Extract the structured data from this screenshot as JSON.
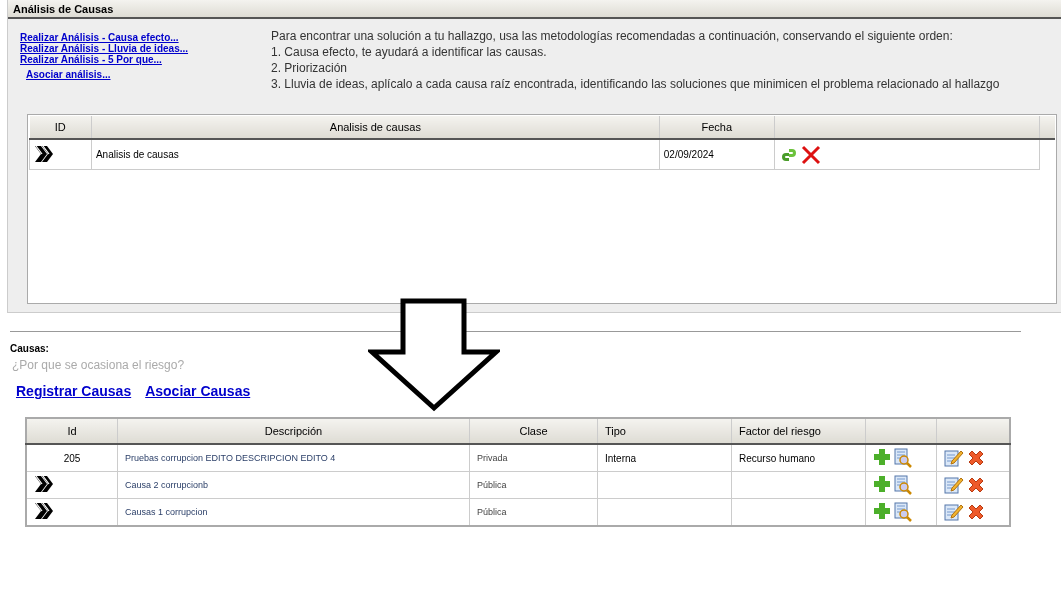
{
  "panel": {
    "title": "Análisis de Causas",
    "links": [
      "Realizar Análisis - Causa efecto...",
      "Realizar Análisis - Lluvia de ideas...",
      "Realizar Análisis - 5 Por que..."
    ],
    "associate_link": "Asociar análisis...",
    "instructions": [
      "Para encontrar una solución a tu hallazgo, usa las metodologías recomendadas a continuación, conservando el siguiente orden:",
      "1. Causa efecto, te ayudará a identificar las causas.",
      "2. Priorización",
      "3. Lluvia de ideas, aplícalo a cada causa raíz encontrada, identificando las soluciones que minimicen el problema relacionado al hallazgo"
    ],
    "table": {
      "columns": [
        "ID",
        "Analisis de causas",
        "Fecha"
      ],
      "rows": [
        {
          "kind": "pending",
          "name": "Analisis de causas",
          "date": "02/09/2024"
        }
      ]
    }
  },
  "causes": {
    "title": "Causas:",
    "question": "¿Por que se ocasiona el riesgo?",
    "links": [
      "Registrar Causas",
      "Asociar Causas"
    ],
    "table": {
      "columns": [
        "Id",
        "Descripción",
        "Clase",
        "Tipo",
        "Factor del riesgo"
      ],
      "rows": [
        {
          "kind": "numbered",
          "id": "205",
          "description": "Pruebas corrupcion EDITO DESCRIPCION EDITO 4",
          "class": "Privada",
          "type": "Interna",
          "factor": "Recurso humano"
        },
        {
          "kind": "pending",
          "description": "Causa 2 corrupcionb",
          "class": "Pública"
        },
        {
          "kind": "pending",
          "description": "Causas 1 corrupcion",
          "class": "Pública"
        }
      ]
    }
  }
}
